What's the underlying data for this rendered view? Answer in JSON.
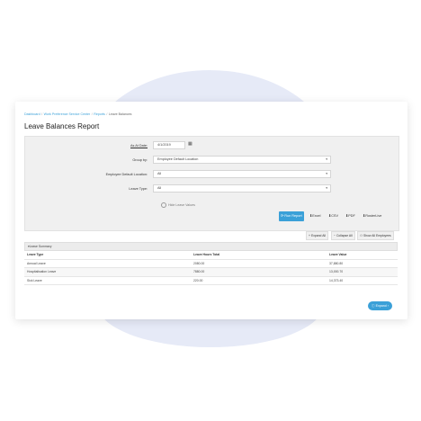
{
  "breadcrumb": [
    {
      "label": "Dashboard"
    },
    {
      "label": "Work Preference Service Center"
    },
    {
      "label": "Reports"
    },
    {
      "label": "Leave Balances"
    }
  ],
  "breadcrumb_separator": "/",
  "page_title": "Leave Balances Report",
  "filters": {
    "as_at_date": {
      "label": "As At Date:",
      "value": "4/1/2019"
    },
    "group_by": {
      "label": "Group by:",
      "value": "Employee Default Location"
    },
    "default_location": {
      "label": "Employee Default Location:",
      "value": "All"
    },
    "leave_type": {
      "label": "Leave Type:",
      "value": "All"
    },
    "hide_checkbox_label": "Hide Leave Values"
  },
  "actions": {
    "run_report": "Run Report",
    "excel": "Excel",
    "csv": "CSV",
    "pdf": "PDF",
    "roster_lite": "RosterLive"
  },
  "grid_toolbar": {
    "expand_all": "Expand All",
    "collapse_all": "Collapse All",
    "show_all_employees": "Show All Employees"
  },
  "grid": {
    "caption": "Leave Summary",
    "columns": [
      "Leave Type",
      "Leave Hours Total",
      "Leave Value"
    ],
    "rows": [
      [
        "Annual Leave",
        "2080.00",
        "37,880.80"
      ],
      [
        "Hospitalisation Leave",
        "7880.00",
        "13,000.70"
      ],
      [
        "Sick Leave",
        "220.00",
        "14,373.40"
      ]
    ]
  },
  "footer_button": "Expand",
  "colors": {
    "accent": "#3aa0d8",
    "background_blob": "#e6eaf7"
  }
}
